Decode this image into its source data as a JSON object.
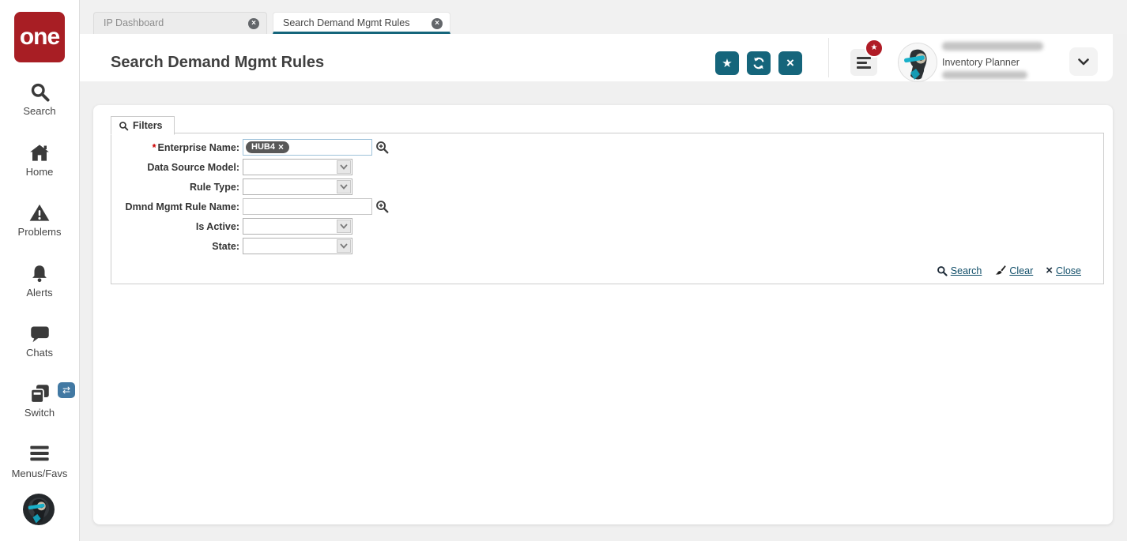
{
  "logo": {
    "text": "one"
  },
  "sidebar": {
    "items": [
      {
        "label": "Search"
      },
      {
        "label": "Home"
      },
      {
        "label": "Problems"
      },
      {
        "label": "Alerts"
      },
      {
        "label": "Chats"
      },
      {
        "label": "Switch"
      },
      {
        "label": "Menus/Favs"
      }
    ]
  },
  "tabs": [
    {
      "label": "IP Dashboard"
    },
    {
      "label": "Search Demand Mgmt Rules"
    }
  ],
  "header": {
    "title": "Search Demand Mgmt Rules",
    "user_role": "Inventory Planner"
  },
  "filters": {
    "title": "Filters",
    "required_marker": "*",
    "fields": [
      {
        "label": "Enterprise Name:",
        "chip": "HUB4",
        "value": ""
      },
      {
        "label": "Data Source Model:",
        "value": ""
      },
      {
        "label": "Rule Type:",
        "value": ""
      },
      {
        "label": "Dmnd Mgmt Rule Name:",
        "value": ""
      },
      {
        "label": "Is Active:",
        "value": ""
      },
      {
        "label": "State:",
        "value": ""
      }
    ],
    "actions": {
      "search": "Search",
      "clear": "Clear",
      "close": "Close"
    }
  },
  "icons": {
    "star_glyph": "★",
    "close_glyph": "×",
    "remove_glyph": "×",
    "swap_glyph": "⇄"
  },
  "colors": {
    "accent_teal": "#15657b",
    "brand_red": "#a81e24",
    "badge_red": "#b01c26",
    "link": "#0f4d68",
    "switch_badge_blue": "#4279a3"
  }
}
